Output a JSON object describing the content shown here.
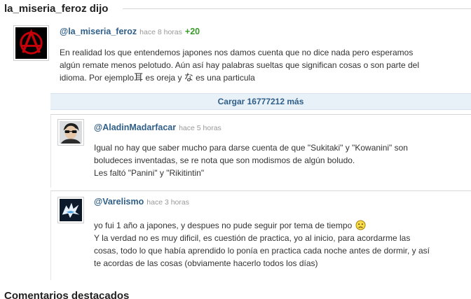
{
  "section_title": "la_miseria_feroz dijo",
  "main_comment": {
    "user": "@la_miseria_feroz",
    "time": "hace 8 horas",
    "votes": "+20",
    "line1": "En realidad los que entendemos japones nos damos cuenta que no dice nada pero esperamos",
    "line2": "algún remate menos pelotudo. Aún así hay palabras sueltas que significan cosas o son parte del",
    "line3_a": "idioma. Por ejemplo",
    "glyph_1": "耳",
    "line3_b": " es oreja y ",
    "glyph_2": "な",
    "line3_c": " es una particula"
  },
  "load_more": "Cargar 16777212 más",
  "replies": [
    {
      "user": "@AladinMadarfacar",
      "time": "hace 5 horas",
      "line1": "Igual no hay que saber mucho para darse cuenta de que \"Sukitaki\" y \"Kowanini\" son",
      "line2": "boludeces inventadas, se re nota que son modismos de algún boludo.",
      "line3": "Les faltó \"Panini\" y \"Rikitintin\""
    },
    {
      "user": "@Varelismo",
      "time": "hace 3 horas",
      "line1": "yo fui 1 año a japones, y despues no pude seguir por tema de tiempo",
      "line2": "Y la verdad no es muy dificil, es cuestión de practica, yo al inicio, para acordarme las",
      "line3": "cosas, todo lo que había aprendido lo ponía en practica cada noche antes de dormir, y así",
      "line4": "te acordas de las cosas (obviamente hacerlo todos los días)"
    }
  ],
  "footer_title": "Comentarios destacados",
  "icons": {
    "main_avatar": "anarchy-symbol-avatar",
    "reply1_avatar": "person-with-sunglasses-avatar",
    "reply2_avatar": "wolf-logo-avatar",
    "emoji": "sad-face-icon"
  },
  "colors": {
    "username": "#2f5f88",
    "votes": "#3a9a2a",
    "load_more_bg": "#e9f1f8"
  }
}
